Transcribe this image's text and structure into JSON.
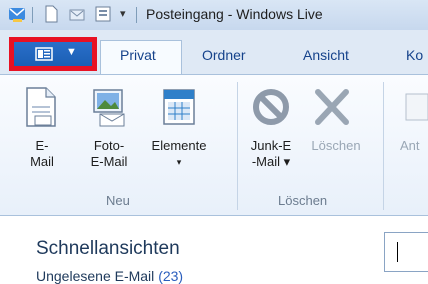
{
  "window": {
    "title": "Posteingang - Windows Live"
  },
  "tabs": [
    {
      "label": "Privat",
      "active": true
    },
    {
      "label": "Ordner",
      "active": false
    },
    {
      "label": "Ansicht",
      "active": false
    },
    {
      "label": "Ko",
      "active": false
    }
  ],
  "ribbon": {
    "groups": [
      {
        "label": "Neu",
        "buttons": [
          {
            "line1": "E-",
            "line2": "Mail",
            "icon": "new-mail-icon"
          },
          {
            "line1": "Foto-",
            "line2": "E-Mail",
            "icon": "photo-mail-icon"
          },
          {
            "line1": "Elemente",
            "line2": "▾",
            "icon": "items-calendar-icon"
          }
        ]
      },
      {
        "label": "Löschen",
        "buttons": [
          {
            "line1": "Junk-E",
            "line2": "-Mail ▾",
            "icon": "junk-icon"
          },
          {
            "line1": "Löschen",
            "line2": "",
            "icon": "delete-x-icon",
            "disabled": true
          }
        ]
      },
      {
        "label": "",
        "buttons": [
          {
            "line1": "Ant",
            "line2": "",
            "icon": "reply-icon",
            "disabled": true
          }
        ]
      }
    ]
  },
  "pane": {
    "title": "Schnellansichten",
    "sub_label": "Ungelesene E-Mail",
    "sub_count": "(23)"
  },
  "colors": {
    "highlight": "#e81123",
    "file_button": "#1b5fb4"
  }
}
